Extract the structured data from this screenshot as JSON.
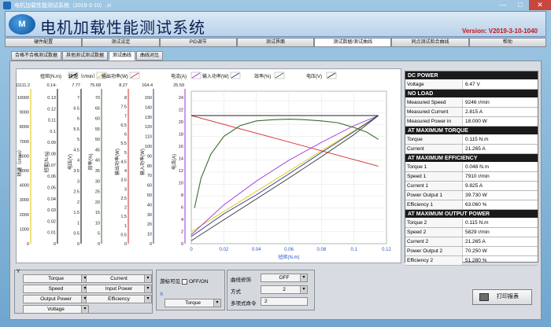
{
  "window": {
    "title": "电机加载性能测试系统（2019-3-10）.vi",
    "min": "—",
    "max": "□",
    "close": "✕"
  },
  "header": {
    "title": "电机加载性能测试系统",
    "version": "Version: V2019-3-10-1040",
    "logo_text": "M"
  },
  "tabs": [
    "硬件配置",
    "测试设定",
    "PID调节",
    "测试界面",
    "测试数据/测试曲线",
    "同点测试和合曲线",
    "帮助"
  ],
  "active_tab": 4,
  "subtabs": [
    "合格不合格测试数据",
    "其他测试测试数据",
    "测试曲线",
    "曲线对比"
  ],
  "active_subtab": 2,
  "chart_data": {
    "type": "line",
    "xlabel": "扭矩(N.m)",
    "x_ticks": [
      "0",
      "0.02",
      "0.04",
      "0.06",
      "0.08",
      "0.1",
      "0.12"
    ],
    "xlim": [
      0,
      0.12
    ],
    "legend": [
      "扭矩(N.m)",
      "转速（r/min）",
      "输出功率(W)",
      "电流(A)",
      "输入功率(W)",
      "效率(%)",
      "电压(V)"
    ],
    "legend_colors": [
      "#000000",
      "#e6c300",
      "#d62728",
      "#9b30d9",
      "#1f3c88",
      "#3a6e2a",
      "#222222"
    ],
    "axes": [
      {
        "label": "转速（r/min）",
        "top": "11111.2",
        "ticks": [
          "10000",
          "9000",
          "8000",
          "7000",
          "6000",
          "5000",
          "4000",
          "3000",
          "2000",
          "1000",
          "0"
        ]
      },
      {
        "label": "扭矩(N.m)",
        "top": "0.14-",
        "ticks": [
          "0.13",
          "0.12",
          "0.11",
          "0.1",
          "0.09",
          "0.08",
          "0.07",
          "0.06",
          "0.05",
          "0.04",
          "0.03",
          "0.02",
          "0.01",
          "0"
        ]
      },
      {
        "label": "电压(V)",
        "top": "7.77",
        "ticks": [
          "7",
          "6.5",
          "6",
          "5.5",
          "5",
          "4.5",
          "4",
          "3.5",
          "3",
          "2.5",
          "2",
          "1.5",
          "1",
          "0.5",
          "0"
        ]
      },
      {
        "label": "效率(%)",
        "top": "75.68",
        "ticks": [
          "70",
          "65",
          "60",
          "55",
          "50",
          "45",
          "40",
          "35",
          "30",
          "25",
          "20",
          "15",
          "10",
          "5",
          "0"
        ]
      },
      {
        "label": "输出功率(W)",
        "top": "8.27",
        "ticks": [
          "8",
          "7.5",
          "7",
          "6.5",
          "6",
          "5.5",
          "5",
          "4.5",
          "4",
          "3.5",
          "3",
          "2.5",
          "2",
          "1.5",
          "1",
          "0.5",
          "0"
        ]
      },
      {
        "label": "输入功率(W)",
        "top": "164.4",
        "ticks": [
          "150",
          "140",
          "130",
          "120",
          "110",
          "100",
          "90",
          "80",
          "70",
          "60",
          "50",
          "40",
          "30",
          "20",
          "10",
          "0"
        ]
      },
      {
        "label": "电流(A)",
        "top": "25.59",
        "ticks": [
          "24",
          "22",
          "20",
          "18",
          "16",
          "14",
          "12",
          "10",
          "8",
          "6",
          "4",
          "2",
          "0"
        ]
      }
    ],
    "series": [
      {
        "name": "转速（r/min）",
        "x": [
          0.0,
          0.115
        ],
        "y": [
          2,
          21.5
        ]
      },
      {
        "name": "输出功率(W)",
        "x": [
          0.0,
          0.115
        ],
        "y": [
          21.5,
          13
        ]
      },
      {
        "name": "电流(A)",
        "x": [
          0.0,
          0.02,
          0.04,
          0.06,
          0.08,
          0.1,
          0.115
        ],
        "y": [
          1.5,
          6.5,
          10.5,
          14,
          17,
          19.8,
          21.5
        ]
      },
      {
        "name": "输入功率(W)",
        "x": [
          0.0,
          0.02,
          0.04,
          0.06,
          0.08,
          0.1,
          0.115
        ],
        "y": [
          1.2,
          5,
          8.2,
          11.7,
          15.3,
          18.8,
          21.5
        ]
      },
      {
        "name": "效率(%)",
        "x": [
          0.002,
          0.006,
          0.012,
          0.02,
          0.03,
          0.04,
          0.05,
          0.06,
          0.07,
          0.08,
          0.09,
          0.1,
          0.108,
          0.115
        ],
        "y": [
          6,
          11,
          15,
          18,
          19.8,
          20.6,
          20.8,
          20.9,
          20.8,
          20.6,
          20.3,
          19.5,
          18.7,
          17.5
        ]
      },
      {
        "name": "电压(V)",
        "x": [
          0.0,
          0.115
        ],
        "y": [
          21.5,
          21.5
        ]
      },
      {
        "name": "",
        "x": [
          0.0,
          0.02,
          0.04,
          0.06,
          0.08,
          0.1,
          0.115
        ],
        "y": [
          0.5,
          4,
          7.5,
          11,
          14.6,
          18.3,
          21.5
        ]
      }
    ]
  },
  "info": [
    {
      "section": "DC POWER",
      "rows": [
        [
          "Voltage",
          "6.47 V"
        ]
      ]
    },
    {
      "section": "NO LOAD",
      "rows": [
        [
          "Measured Speed",
          "9246 r/min"
        ],
        [
          "Measured Current",
          "2.815 A"
        ],
        [
          "Measured Power in",
          "18.000 W"
        ]
      ]
    },
    {
      "section": "AT MAXIMUM TORQUE",
      "rows": [
        [
          "Torque",
          "0.115 N.m"
        ],
        [
          "Current",
          "21.265 A"
        ]
      ]
    },
    {
      "section": "AT MAXIMUM EFFICIENCY",
      "rows": [
        [
          "Torque 1",
          "0.048 N.m"
        ],
        [
          "Speed 1",
          "7910 r/min"
        ],
        [
          "Current 1",
          "9.825 A"
        ],
        [
          "Power Output 1",
          "39.730 W"
        ],
        [
          "Efficiency 1",
          "63.060 %"
        ]
      ]
    },
    {
      "section": "AT MAXIMUM OUTPUT POWER",
      "rows": [
        [
          "Torque 2",
          "0.115 N.m"
        ],
        [
          "Speed 2",
          "5829 r/min"
        ],
        [
          "Current 2",
          "21.265 A"
        ],
        [
          "Power Output 2",
          "70.250 W"
        ],
        [
          "Efficiency 2",
          "51.280 %"
        ]
      ]
    }
  ],
  "controls": {
    "y_label": "Y",
    "y_left": [
      "Torque",
      "Speed",
      "Output Power",
      "Voltage"
    ],
    "y_right": [
      "Current",
      "Input Power",
      "Efficiency"
    ],
    "x_label": "X",
    "visible_label": "游标可见",
    "visible_state": "OFF/ON",
    "x_select": "Torque",
    "curve_fit_label": "曲线修饰",
    "curve_fit_value": "OFF",
    "method_label": "方式",
    "method_value": "2",
    "poly_label": "多项式命令",
    "poly_value": "2",
    "arrow": "▾"
  },
  "print_button": "打印报表"
}
